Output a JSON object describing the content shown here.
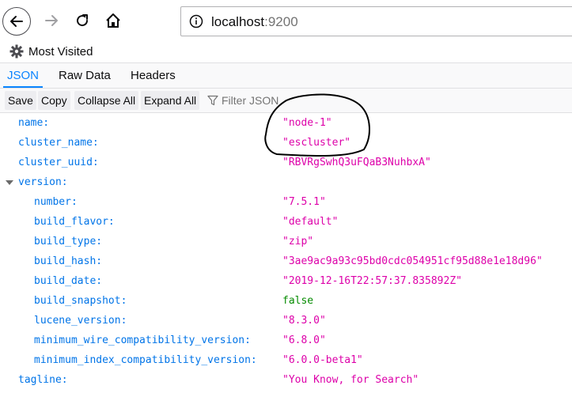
{
  "browser": {
    "url_host": "localhost",
    "url_port": ":9200",
    "back_icon": "back-arrow-icon",
    "forward_icon": "forward-arrow-icon",
    "reload_icon": "reload-icon",
    "home_icon": "home-icon"
  },
  "bookmarks": {
    "most_visited": "Most Visited"
  },
  "viewer": {
    "tabs": [
      "JSON",
      "Raw Data",
      "Headers"
    ],
    "active_tab": "JSON",
    "toolbar": {
      "save": "Save",
      "copy": "Copy",
      "collapse_all": "Collapse All",
      "expand_all": "Expand All",
      "filter_placeholder": "Filter JSON"
    }
  },
  "json": {
    "rows": [
      {
        "key": "name:",
        "value": "\"node-1\""
      },
      {
        "key": "cluster_name:",
        "value": "\"escluster\""
      },
      {
        "key": "cluster_uuid:",
        "value": "\"RBVRgSwhQ3uFQaB3NuhbxA\""
      },
      {
        "key": "version:",
        "value": ""
      },
      {
        "key": "number:",
        "value": "\"7.5.1\""
      },
      {
        "key": "build_flavor:",
        "value": "\"default\""
      },
      {
        "key": "build_type:",
        "value": "\"zip\""
      },
      {
        "key": "build_hash:",
        "value": "\"3ae9ac9a93c95bd0cdc054951cf95d88e1e18d96\""
      },
      {
        "key": "build_date:",
        "value": "\"2019-12-16T22:57:37.835892Z\""
      },
      {
        "key": "build_snapshot:",
        "value": "false"
      },
      {
        "key": "lucene_version:",
        "value": "\"8.3.0\""
      },
      {
        "key": "minimum_wire_compatibility_version:",
        "value": "\"6.8.0\""
      },
      {
        "key": "minimum_index_compatibility_version:",
        "value": "\"6.0.0-beta1\""
      },
      {
        "key": "tagline:",
        "value": "\"You Know, for Search\""
      }
    ]
  },
  "colors": {
    "key": "#0074e8",
    "string": "#dd00a9",
    "boolean": "#058b00",
    "accent": "#0a84ff"
  }
}
